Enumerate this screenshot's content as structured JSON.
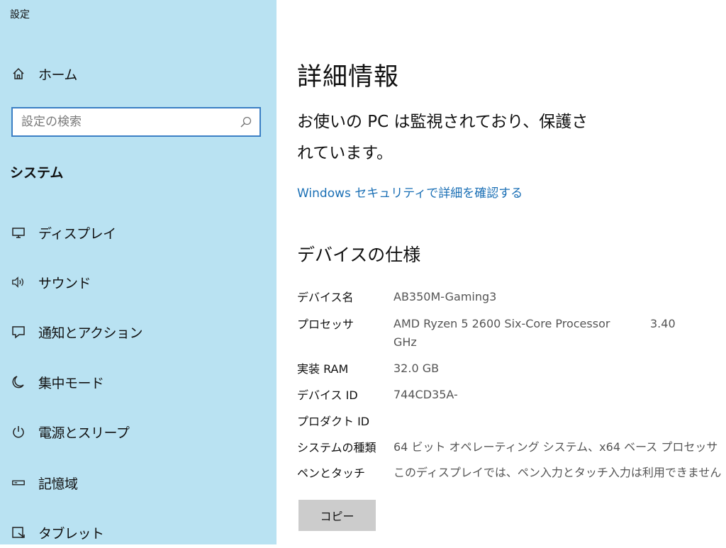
{
  "app": {
    "title": "設定"
  },
  "sidebar": {
    "home_label": "ホーム",
    "search_placeholder": "設定の検索",
    "section_title": "システム",
    "items": [
      {
        "label": "ディスプレイ",
        "icon": "monitor-icon"
      },
      {
        "label": "サウンド",
        "icon": "speaker-icon"
      },
      {
        "label": "通知とアクション",
        "icon": "notification-icon"
      },
      {
        "label": "集中モード",
        "icon": "moon-icon"
      },
      {
        "label": "電源とスリープ",
        "icon": "power-icon"
      },
      {
        "label": "記憶域",
        "icon": "storage-icon"
      },
      {
        "label": "タブレット",
        "icon": "tablet-icon"
      }
    ]
  },
  "main": {
    "title": "詳細情報",
    "status_text": "お使いの PC は監視されており、保護されています。",
    "security_link": "Windows セキュリティで詳細を確認する",
    "spec_title": "デバイスの仕様",
    "specs": [
      {
        "label": "デバイス名",
        "value": "AB350M-Gaming3"
      },
      {
        "label": "プロセッサ",
        "value": "AMD Ryzen 5 2600 Six-Core Processor",
        "value_extra": "3.40",
        "value_line2": "GHz"
      },
      {
        "label": "実装 RAM",
        "value": "32.0 GB"
      },
      {
        "label": "デバイス ID",
        "value": "744CD35A-"
      },
      {
        "label": "プロダクト ID",
        "value": ""
      },
      {
        "label": "システムの種類",
        "value": "64 ビット オペレーティング システム、x64 ベース プロセッサ"
      },
      {
        "label": "ペンとタッチ",
        "value": "このディスプレイでは、ペン入力とタッチ入力は利用できません"
      }
    ],
    "copy_button": "コピー"
  },
  "colors": {
    "sidebar_bg": "#b9e2f2",
    "link": "#1a6fb5",
    "button_bg": "#cccccc",
    "search_border": "#3b7fc4"
  }
}
